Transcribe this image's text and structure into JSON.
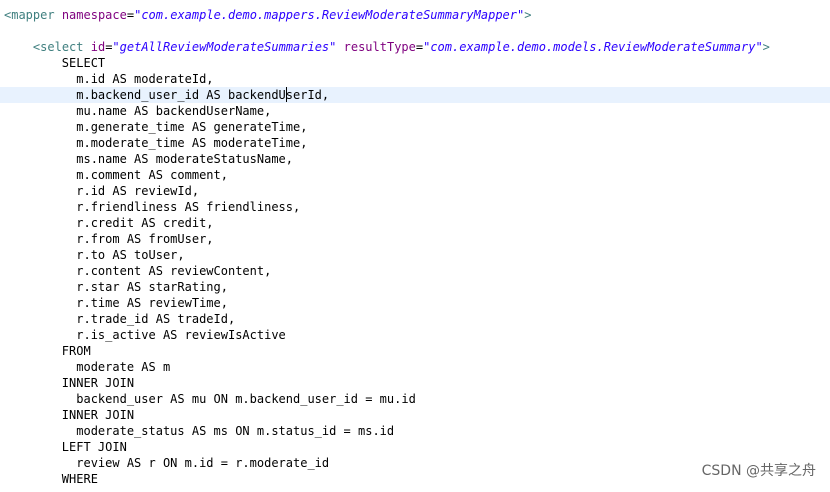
{
  "editor": {
    "lines": [
      {
        "indent": "",
        "tokens": [
          {
            "t": "<",
            "c": "tag"
          },
          {
            "t": "mapper",
            "c": "tag"
          },
          {
            "t": " ",
            "c": "punct"
          },
          {
            "t": "namespace",
            "c": "attr"
          },
          {
            "t": "=",
            "c": "punct"
          },
          {
            "t": "\"com.example.demo.mappers.ReviewModerateSummaryMapper\"",
            "c": "val"
          },
          {
            "t": ">",
            "c": "tag"
          }
        ]
      },
      {
        "indent": "",
        "tokens": []
      },
      {
        "indent": "    ",
        "tokens": [
          {
            "t": "<",
            "c": "tag"
          },
          {
            "t": "select",
            "c": "tag"
          },
          {
            "t": " ",
            "c": "punct"
          },
          {
            "t": "id",
            "c": "attr"
          },
          {
            "t": "=",
            "c": "punct"
          },
          {
            "t": "\"getAllReviewModerateSummaries\"",
            "c": "val"
          },
          {
            "t": " ",
            "c": "punct"
          },
          {
            "t": "resultType",
            "c": "attr"
          },
          {
            "t": "=",
            "c": "punct"
          },
          {
            "t": "\"com.example.demo.models.ReviewModerateSummary\"",
            "c": "val"
          },
          {
            "t": ">",
            "c": "tag"
          }
        ]
      },
      {
        "indent": "        ",
        "tokens": [
          {
            "t": "SELECT",
            "c": "punct"
          }
        ]
      },
      {
        "indent": "          ",
        "tokens": [
          {
            "t": "m.id AS moderateId,",
            "c": "punct"
          }
        ]
      },
      {
        "indent": "          ",
        "tokens": [
          {
            "t": "m.backend_user_id AS backendUserId,",
            "c": "punct"
          }
        ],
        "current": true
      },
      {
        "indent": "          ",
        "tokens": [
          {
            "t": "mu.name AS backendUserName,",
            "c": "punct"
          }
        ]
      },
      {
        "indent": "          ",
        "tokens": [
          {
            "t": "m.generate_time AS generateTime,",
            "c": "punct"
          }
        ]
      },
      {
        "indent": "          ",
        "tokens": [
          {
            "t": "m.moderate_time AS moderateTime,",
            "c": "punct"
          }
        ]
      },
      {
        "indent": "          ",
        "tokens": [
          {
            "t": "ms.name AS moderateStatusName,",
            "c": "punct"
          }
        ]
      },
      {
        "indent": "          ",
        "tokens": [
          {
            "t": "m.comment AS comment,",
            "c": "punct"
          }
        ]
      },
      {
        "indent": "          ",
        "tokens": [
          {
            "t": "r.id AS reviewId,",
            "c": "punct"
          }
        ]
      },
      {
        "indent": "          ",
        "tokens": [
          {
            "t": "r.friendliness AS friendliness,",
            "c": "punct"
          }
        ]
      },
      {
        "indent": "          ",
        "tokens": [
          {
            "t": "r.credit AS credit,",
            "c": "punct"
          }
        ]
      },
      {
        "indent": "          ",
        "tokens": [
          {
            "t": "r.from AS fromUser,",
            "c": "punct"
          }
        ]
      },
      {
        "indent": "          ",
        "tokens": [
          {
            "t": "r.to AS toUser,",
            "c": "punct"
          }
        ]
      },
      {
        "indent": "          ",
        "tokens": [
          {
            "t": "r.content AS reviewContent,",
            "c": "punct"
          }
        ]
      },
      {
        "indent": "          ",
        "tokens": [
          {
            "t": "r.star AS starRating,",
            "c": "punct"
          }
        ]
      },
      {
        "indent": "          ",
        "tokens": [
          {
            "t": "r.time AS reviewTime,",
            "c": "punct"
          }
        ]
      },
      {
        "indent": "          ",
        "tokens": [
          {
            "t": "r.trade_id AS tradeId,",
            "c": "punct"
          }
        ]
      },
      {
        "indent": "          ",
        "tokens": [
          {
            "t": "r.is_active AS reviewIsActive",
            "c": "punct"
          }
        ]
      },
      {
        "indent": "        ",
        "tokens": [
          {
            "t": "FROM",
            "c": "punct"
          }
        ]
      },
      {
        "indent": "          ",
        "tokens": [
          {
            "t": "moderate AS m",
            "c": "punct"
          }
        ]
      },
      {
        "indent": "        ",
        "tokens": [
          {
            "t": "INNER JOIN",
            "c": "punct"
          }
        ]
      },
      {
        "indent": "          ",
        "tokens": [
          {
            "t": "backend_user AS mu ON m.backend_user_id = mu.id",
            "c": "punct"
          }
        ]
      },
      {
        "indent": "        ",
        "tokens": [
          {
            "t": "INNER JOIN",
            "c": "punct"
          }
        ]
      },
      {
        "indent": "          ",
        "tokens": [
          {
            "t": "moderate_status AS ms ON m.status_id = ms.id",
            "c": "punct"
          }
        ]
      },
      {
        "indent": "        ",
        "tokens": [
          {
            "t": "LEFT JOIN",
            "c": "punct"
          }
        ]
      },
      {
        "indent": "          ",
        "tokens": [
          {
            "t": "review AS r ON m.id = r.moderate_id",
            "c": "punct"
          }
        ]
      },
      {
        "indent": "        ",
        "tokens": [
          {
            "t": "WHERE",
            "c": "punct"
          }
        ]
      }
    ]
  },
  "watermark": "CSDN @共享之舟"
}
